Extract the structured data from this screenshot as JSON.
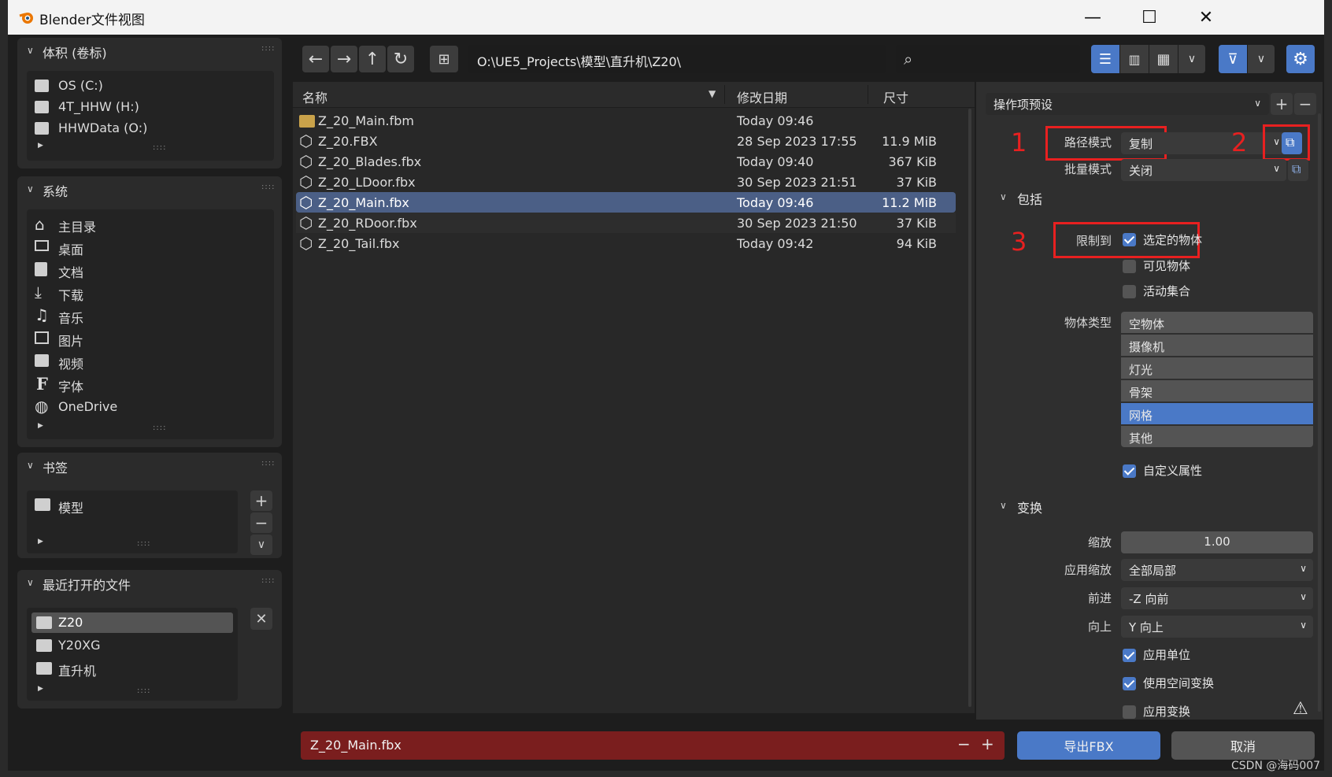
{
  "window": {
    "title": "Blender文件视图",
    "minimize": "—",
    "maximize": "☐",
    "close": "✕"
  },
  "sidebar": {
    "volumes": {
      "title": "体积 (卷标)",
      "items": [
        {
          "label": "OS (C:)"
        },
        {
          "label": "4T_HHW (H:)"
        },
        {
          "label": "HHWData (O:)"
        }
      ]
    },
    "system": {
      "title": "系统",
      "items": [
        {
          "label": "主目录",
          "icon": "home-icon"
        },
        {
          "label": "桌面",
          "icon": "desktop-icon"
        },
        {
          "label": "文档",
          "icon": "documents-icon"
        },
        {
          "label": "下载",
          "icon": "download-icon"
        },
        {
          "label": "音乐",
          "icon": "music-icon"
        },
        {
          "label": "图片",
          "icon": "image-icon"
        },
        {
          "label": "视频",
          "icon": "video-icon"
        },
        {
          "label": "字体",
          "icon": "font-icon"
        },
        {
          "label": "OneDrive",
          "icon": "onedrive-icon"
        }
      ]
    },
    "bookmarks": {
      "title": "书签",
      "items": [
        {
          "label": "模型"
        }
      ]
    },
    "recent": {
      "title": "最近打开的文件",
      "items": [
        {
          "label": "Z20"
        },
        {
          "label": "Y20XG"
        },
        {
          "label": "直升机"
        }
      ]
    }
  },
  "toolbar": {
    "path": "O:\\UE5_Projects\\模型\\直升机\\Z20\\",
    "search_placeholder": ""
  },
  "filelist": {
    "columns": {
      "name": "名称",
      "date": "修改日期",
      "size": "尺寸"
    },
    "rows": [
      {
        "name": "Z_20_Main.fbm",
        "date": "Today 09:46",
        "size": "",
        "type": "folder"
      },
      {
        "name": "Z_20.FBX",
        "date": "28 Sep 2023 17:55",
        "size": "11.9 MiB",
        "type": "file"
      },
      {
        "name": "Z_20_Blades.fbx",
        "date": "Today 09:40",
        "size": "367 KiB",
        "type": "file"
      },
      {
        "name": "Z_20_LDoor.fbx",
        "date": "30 Sep 2023 21:51",
        "size": "37 KiB",
        "type": "file"
      },
      {
        "name": "Z_20_Main.fbx",
        "date": "Today 09:46",
        "size": "11.2 MiB",
        "type": "file",
        "selected": true
      },
      {
        "name": "Z_20_RDoor.fbx",
        "date": "30 Sep 2023 21:50",
        "size": "37 KiB",
        "type": "file"
      },
      {
        "name": "Z_20_Tail.fbx",
        "date": "Today 09:42",
        "size": "94 KiB",
        "type": "file"
      }
    ]
  },
  "props": {
    "preset_label": "操作项预设",
    "path_mode": {
      "label": "路径模式",
      "value": "复制"
    },
    "batch_mode": {
      "label": "批量模式",
      "value": "关闭"
    },
    "include": {
      "title": "包括",
      "limit_to": "限制到",
      "selected_objects": "选定的物体",
      "visible_objects": "可见物体",
      "active_collection": "活动集合",
      "object_types_label": "物体类型",
      "object_types": [
        "空物体",
        "摄像机",
        "灯光",
        "骨架",
        "网格",
        "其他"
      ],
      "selected_type": "网格",
      "custom_props": "自定义属性"
    },
    "transform": {
      "title": "变换",
      "scale_label": "缩放",
      "scale_value": "1.00",
      "apply_scale_label": "应用缩放",
      "apply_scale_value": "全部局部",
      "forward_label": "前进",
      "forward_value": "-Z 向前",
      "up_label": "向上",
      "up_value": "Y 向上",
      "apply_unit": "应用单位",
      "use_space_transform": "使用空间变换",
      "apply_transform": "应用变换"
    }
  },
  "annotations": {
    "n1": "1",
    "n2": "2",
    "n3": "3"
  },
  "footer": {
    "filename": "Z_20_Main.fbx",
    "minus": "−",
    "plus": "+",
    "export": "导出FBX",
    "cancel": "取消"
  },
  "watermark": "CSDN @海码007",
  "colors": {
    "accent": "#4a79c7",
    "selected_row": "#4b5f86",
    "filename_bg": "#7a1e1e",
    "annotation_red": "#e82020"
  }
}
